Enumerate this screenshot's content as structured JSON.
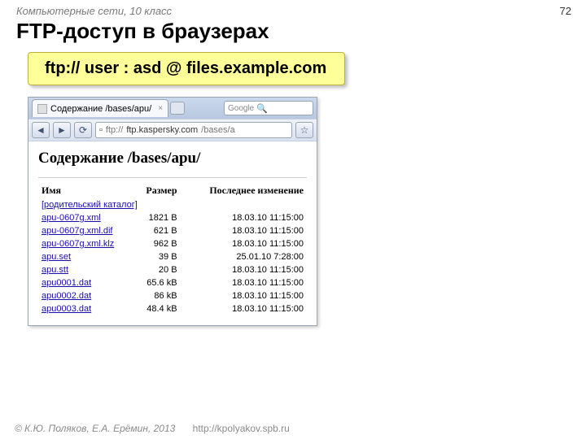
{
  "header": {
    "course": "Компьютерные сети, 10 класс",
    "page_number": "72",
    "title": "FTP-доступ в браузерах"
  },
  "ftp_example": {
    "protocol": "ftp:// ",
    "user": "user",
    "sep1": " : ",
    "pass": "asd",
    "sep2": " @ ",
    "host": "files.example.com"
  },
  "browser": {
    "tab_title": "Содержание /bases/apu/",
    "search_placeholder": "Google",
    "url_prefix": "ftp://",
    "url_host": "ftp.kaspersky.com",
    "url_path": "/bases/a",
    "page_heading": "Содержание /bases/apu/",
    "columns": {
      "name": "Имя",
      "size": "Размер",
      "modified": "Последнее изменение"
    },
    "parent_label": "[родительский каталог]",
    "rows": [
      {
        "name": "apu-0607g.xml",
        "size": "1821 B",
        "modified": "18.03.10 11:15:00"
      },
      {
        "name": "apu-0607g.xml.dif",
        "size": "621 B",
        "modified": "18.03.10 11:15:00"
      },
      {
        "name": "apu-0607g.xml.klz",
        "size": "962 B",
        "modified": "18.03.10 11:15:00"
      },
      {
        "name": "apu.set",
        "size": "39 B",
        "modified": "25.01.10 7:28:00"
      },
      {
        "name": "apu.stt",
        "size": "20 B",
        "modified": "18.03.10 11:15:00"
      },
      {
        "name": "apu0001.dat",
        "size": "65.6 kB",
        "modified": "18.03.10 11:15:00"
      },
      {
        "name": "apu0002.dat",
        "size": "86 kB",
        "modified": "18.03.10 11:15:00"
      },
      {
        "name": "apu0003.dat",
        "size": "48.4 kB",
        "modified": "18.03.10 11:15:00"
      }
    ]
  },
  "footer": {
    "copyright": "© К.Ю. Поляков, Е.А. Ерёмин, 2013",
    "url": "http://kpolyakov.spb.ru"
  }
}
